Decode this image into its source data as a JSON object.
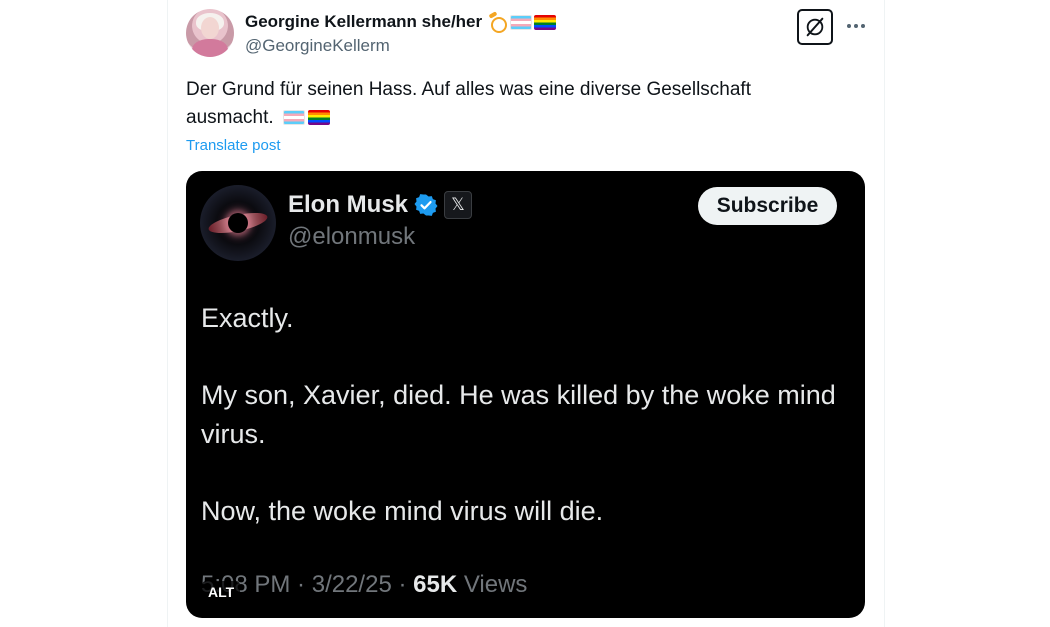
{
  "author": {
    "display_name": "Georgine Kellermann she/her",
    "handle": "@GeorgineKellerm",
    "name_emojis": [
      "ring-emoji",
      "transgender-flag-emoji",
      "rainbow-flag-emoji"
    ]
  },
  "post": {
    "text": "Der Grund für seinen Hass. Auf alles was eine diverse Gesellschaft ausmacht.",
    "text_emojis": [
      "transgender-flag-emoji",
      "rainbow-flag-emoji"
    ],
    "translate_label": "Translate post"
  },
  "actions": {
    "grok_icon": "grok-icon",
    "more_icon": "more-dots-icon"
  },
  "embedded_image": {
    "display_name": "Elon Musk",
    "handle": "@elonmusk",
    "subscribe_label": "Subscribe",
    "body": {
      "line1": "Exactly.",
      "line2": "My son, Xavier, died. He was killed by the woke mind virus.",
      "line3": "Now, the woke mind virus will die."
    },
    "meta": {
      "time": "5:08 PM",
      "sep1": " · ",
      "date": "3/22/25",
      "sep2": " · ",
      "views_count": "65K",
      "views_label": " Views"
    },
    "alt_label": "ALT"
  },
  "colors": {
    "link": "#1d9bf0",
    "muted": "#536471",
    "dark_bg": "#000000",
    "dark_text": "#e7e9ea",
    "dark_muted": "#71767b",
    "verified": "#1d9bf0"
  }
}
